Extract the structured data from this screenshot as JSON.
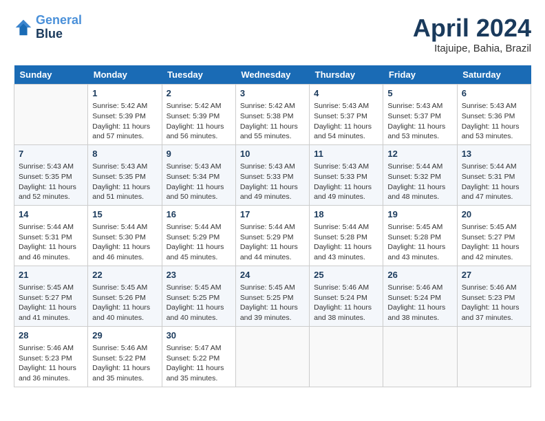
{
  "header": {
    "logo_line1": "General",
    "logo_line2": "Blue",
    "month_title": "April 2024",
    "subtitle": "Itajuipe, Bahia, Brazil"
  },
  "days_of_week": [
    "Sunday",
    "Monday",
    "Tuesday",
    "Wednesday",
    "Thursday",
    "Friday",
    "Saturday"
  ],
  "weeks": [
    [
      {
        "day": "",
        "empty": true
      },
      {
        "day": "1",
        "sunrise": "Sunrise: 5:42 AM",
        "sunset": "Sunset: 5:39 PM",
        "daylight": "Daylight: 11 hours and 57 minutes."
      },
      {
        "day": "2",
        "sunrise": "Sunrise: 5:42 AM",
        "sunset": "Sunset: 5:39 PM",
        "daylight": "Daylight: 11 hours and 56 minutes."
      },
      {
        "day": "3",
        "sunrise": "Sunrise: 5:42 AM",
        "sunset": "Sunset: 5:38 PM",
        "daylight": "Daylight: 11 hours and 55 minutes."
      },
      {
        "day": "4",
        "sunrise": "Sunrise: 5:43 AM",
        "sunset": "Sunset: 5:37 PM",
        "daylight": "Daylight: 11 hours and 54 minutes."
      },
      {
        "day": "5",
        "sunrise": "Sunrise: 5:43 AM",
        "sunset": "Sunset: 5:37 PM",
        "daylight": "Daylight: 11 hours and 53 minutes."
      },
      {
        "day": "6",
        "sunrise": "Sunrise: 5:43 AM",
        "sunset": "Sunset: 5:36 PM",
        "daylight": "Daylight: 11 hours and 53 minutes."
      }
    ],
    [
      {
        "day": "7",
        "sunrise": "Sunrise: 5:43 AM",
        "sunset": "Sunset: 5:35 PM",
        "daylight": "Daylight: 11 hours and 52 minutes."
      },
      {
        "day": "8",
        "sunrise": "Sunrise: 5:43 AM",
        "sunset": "Sunset: 5:35 PM",
        "daylight": "Daylight: 11 hours and 51 minutes."
      },
      {
        "day": "9",
        "sunrise": "Sunrise: 5:43 AM",
        "sunset": "Sunset: 5:34 PM",
        "daylight": "Daylight: 11 hours and 50 minutes."
      },
      {
        "day": "10",
        "sunrise": "Sunrise: 5:43 AM",
        "sunset": "Sunset: 5:33 PM",
        "daylight": "Daylight: 11 hours and 49 minutes."
      },
      {
        "day": "11",
        "sunrise": "Sunrise: 5:43 AM",
        "sunset": "Sunset: 5:33 PM",
        "daylight": "Daylight: 11 hours and 49 minutes."
      },
      {
        "day": "12",
        "sunrise": "Sunrise: 5:44 AM",
        "sunset": "Sunset: 5:32 PM",
        "daylight": "Daylight: 11 hours and 48 minutes."
      },
      {
        "day": "13",
        "sunrise": "Sunrise: 5:44 AM",
        "sunset": "Sunset: 5:31 PM",
        "daylight": "Daylight: 11 hours and 47 minutes."
      }
    ],
    [
      {
        "day": "14",
        "sunrise": "Sunrise: 5:44 AM",
        "sunset": "Sunset: 5:31 PM",
        "daylight": "Daylight: 11 hours and 46 minutes."
      },
      {
        "day": "15",
        "sunrise": "Sunrise: 5:44 AM",
        "sunset": "Sunset: 5:30 PM",
        "daylight": "Daylight: 11 hours and 46 minutes."
      },
      {
        "day": "16",
        "sunrise": "Sunrise: 5:44 AM",
        "sunset": "Sunset: 5:29 PM",
        "daylight": "Daylight: 11 hours and 45 minutes."
      },
      {
        "day": "17",
        "sunrise": "Sunrise: 5:44 AM",
        "sunset": "Sunset: 5:29 PM",
        "daylight": "Daylight: 11 hours and 44 minutes."
      },
      {
        "day": "18",
        "sunrise": "Sunrise: 5:44 AM",
        "sunset": "Sunset: 5:28 PM",
        "daylight": "Daylight: 11 hours and 43 minutes."
      },
      {
        "day": "19",
        "sunrise": "Sunrise: 5:45 AM",
        "sunset": "Sunset: 5:28 PM",
        "daylight": "Daylight: 11 hours and 43 minutes."
      },
      {
        "day": "20",
        "sunrise": "Sunrise: 5:45 AM",
        "sunset": "Sunset: 5:27 PM",
        "daylight": "Daylight: 11 hours and 42 minutes."
      }
    ],
    [
      {
        "day": "21",
        "sunrise": "Sunrise: 5:45 AM",
        "sunset": "Sunset: 5:27 PM",
        "daylight": "Daylight: 11 hours and 41 minutes."
      },
      {
        "day": "22",
        "sunrise": "Sunrise: 5:45 AM",
        "sunset": "Sunset: 5:26 PM",
        "daylight": "Daylight: 11 hours and 40 minutes."
      },
      {
        "day": "23",
        "sunrise": "Sunrise: 5:45 AM",
        "sunset": "Sunset: 5:25 PM",
        "daylight": "Daylight: 11 hours and 40 minutes."
      },
      {
        "day": "24",
        "sunrise": "Sunrise: 5:45 AM",
        "sunset": "Sunset: 5:25 PM",
        "daylight": "Daylight: 11 hours and 39 minutes."
      },
      {
        "day": "25",
        "sunrise": "Sunrise: 5:46 AM",
        "sunset": "Sunset: 5:24 PM",
        "daylight": "Daylight: 11 hours and 38 minutes."
      },
      {
        "day": "26",
        "sunrise": "Sunrise: 5:46 AM",
        "sunset": "Sunset: 5:24 PM",
        "daylight": "Daylight: 11 hours and 38 minutes."
      },
      {
        "day": "27",
        "sunrise": "Sunrise: 5:46 AM",
        "sunset": "Sunset: 5:23 PM",
        "daylight": "Daylight: 11 hours and 37 minutes."
      }
    ],
    [
      {
        "day": "28",
        "sunrise": "Sunrise: 5:46 AM",
        "sunset": "Sunset: 5:23 PM",
        "daylight": "Daylight: 11 hours and 36 minutes."
      },
      {
        "day": "29",
        "sunrise": "Sunrise: 5:46 AM",
        "sunset": "Sunset: 5:22 PM",
        "daylight": "Daylight: 11 hours and 35 minutes."
      },
      {
        "day": "30",
        "sunrise": "Sunrise: 5:47 AM",
        "sunset": "Sunset: 5:22 PM",
        "daylight": "Daylight: 11 hours and 35 minutes."
      },
      {
        "day": "",
        "empty": true
      },
      {
        "day": "",
        "empty": true
      },
      {
        "day": "",
        "empty": true
      },
      {
        "day": "",
        "empty": true
      }
    ]
  ]
}
